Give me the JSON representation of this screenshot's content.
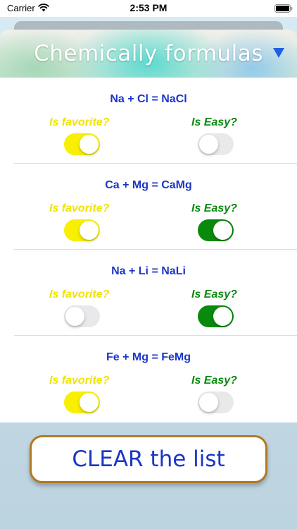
{
  "status_bar": {
    "carrier": "Carrier",
    "time": "2:53 PM"
  },
  "header": {
    "title": "Chemically formulas",
    "dropdown_icon": "triangle-down-icon",
    "dropdown_color": "#1f5fe0"
  },
  "formulas": [
    {
      "formula": "Na + Cl = NaCl",
      "favorite_label": "Is favorite?",
      "easy_label": "Is Easy?",
      "is_favorite": true,
      "is_easy": false
    },
    {
      "formula": "Ca + Mg = CaMg",
      "favorite_label": "Is favorite?",
      "easy_label": "Is Easy?",
      "is_favorite": true,
      "is_easy": true
    },
    {
      "formula": "Na + Li = NaLi",
      "favorite_label": "Is favorite?",
      "easy_label": "Is Easy?",
      "is_favorite": false,
      "is_easy": true
    },
    {
      "formula": "Fe + Mg = FeMg",
      "favorite_label": "Is favorite?",
      "easy_label": "Is Easy?",
      "is_favorite": true,
      "is_easy": false
    }
  ],
  "clear_button": {
    "label": "CLEAR the list"
  },
  "colors": {
    "formula_text": "#1b36c8",
    "favorite_accent": "#f8f000",
    "easy_accent": "#0a8a0c",
    "button_border": "#b07a22"
  }
}
